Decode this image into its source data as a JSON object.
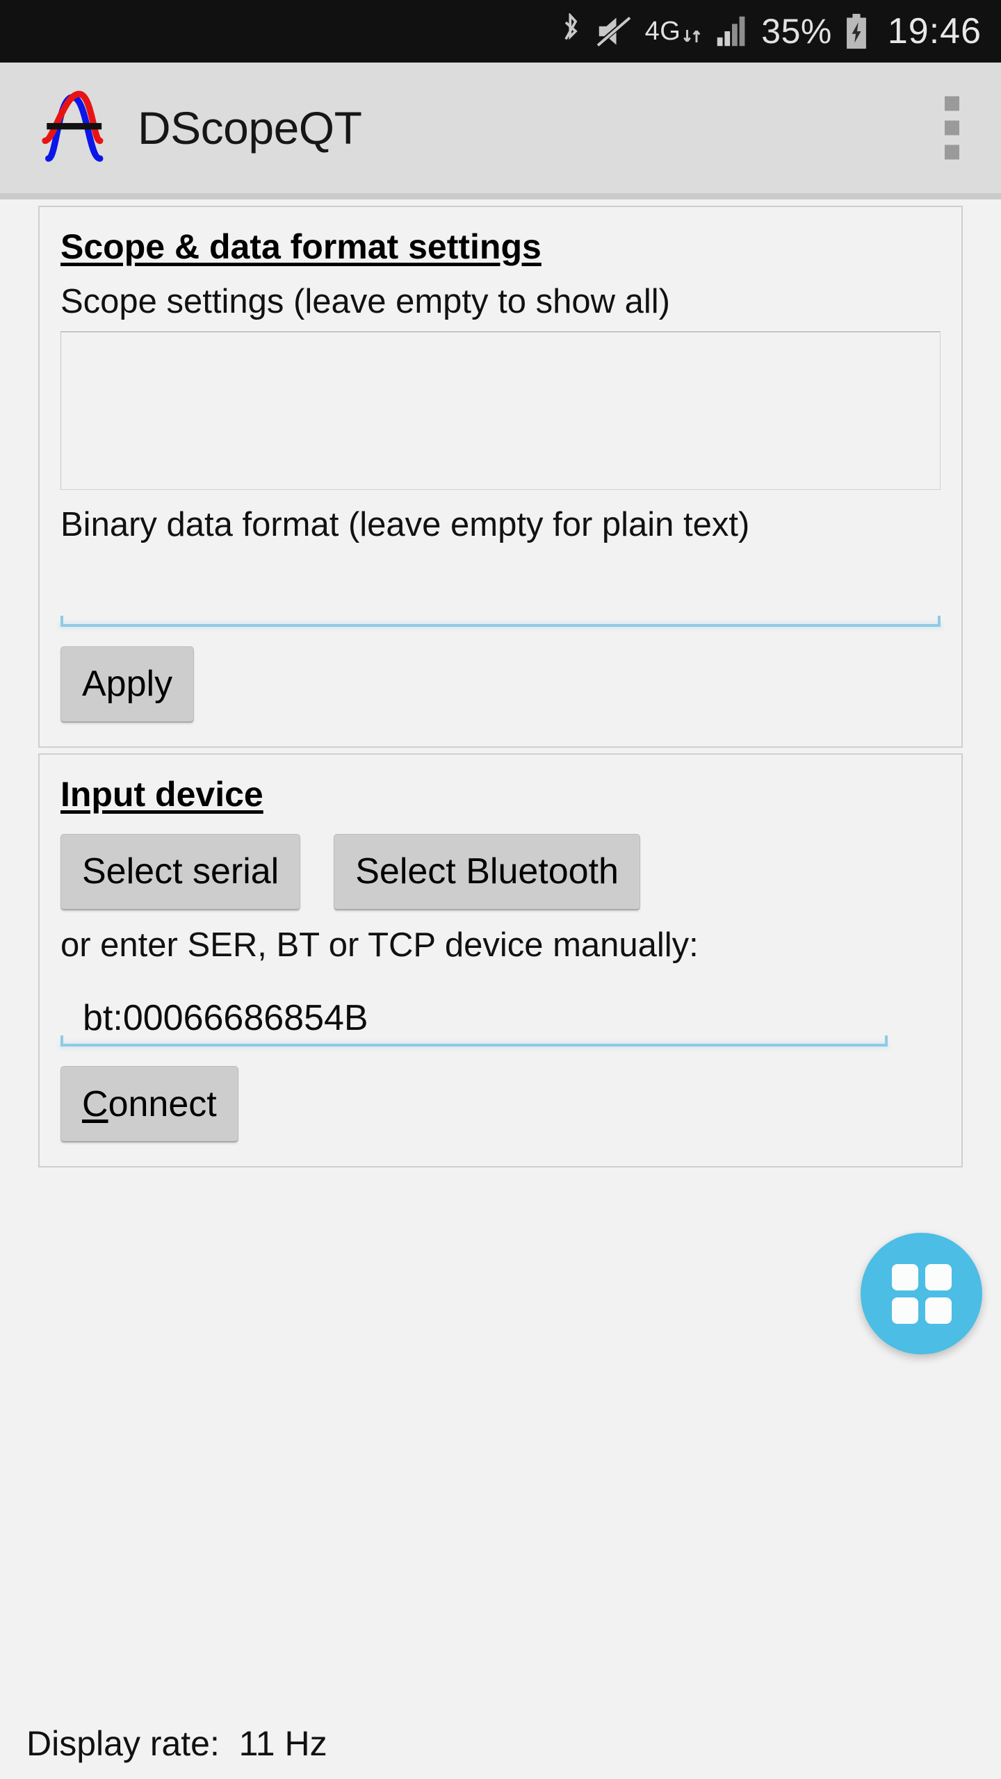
{
  "status_bar": {
    "bluetooth_icon": "bluetooth-icon",
    "mute_icon": "volume-muted-icon",
    "network_label": "4G",
    "data_arrows_icon": "data-transfer-icon",
    "signal_icon": "signal-bars-icon",
    "battery_percent": "35%",
    "battery_icon": "battery-charging-icon",
    "clock": "19:46"
  },
  "app_bar": {
    "title": "DScopeQT",
    "logo_icon": "waveform-logo-icon",
    "overflow_icon": "overflow-menu-icon"
  },
  "scope_card": {
    "title": "Scope & data format settings",
    "scope_settings_label": "Scope settings (leave empty to show all)",
    "scope_settings_value": "",
    "binary_format_label": "Binary data format (leave empty for plain text)",
    "binary_format_value": "",
    "apply_label": "Apply"
  },
  "input_device_card": {
    "title": "Input device",
    "select_serial_label": "Select serial",
    "select_bluetooth_label": "Select Bluetooth",
    "manual_label": "or enter SER, BT or TCP device manually:",
    "device_value": "bt:00066686854B",
    "connect_mnemonic": "C",
    "connect_rest": "onnect"
  },
  "fab": {
    "icon": "grid-apps-icon"
  },
  "footer": {
    "display_rate": "Display rate:  11 Hz"
  },
  "colors": {
    "status_bar_bg": "#111111",
    "app_bar_bg": "#dcdcdc",
    "page_bg": "#f2f2f2",
    "button_bg": "#cdcdcd",
    "edit_underline": "#8fcbe4",
    "fab_bg": "#4cbde4",
    "logo_blue": "#0b16e8",
    "logo_red": "#e81414"
  }
}
